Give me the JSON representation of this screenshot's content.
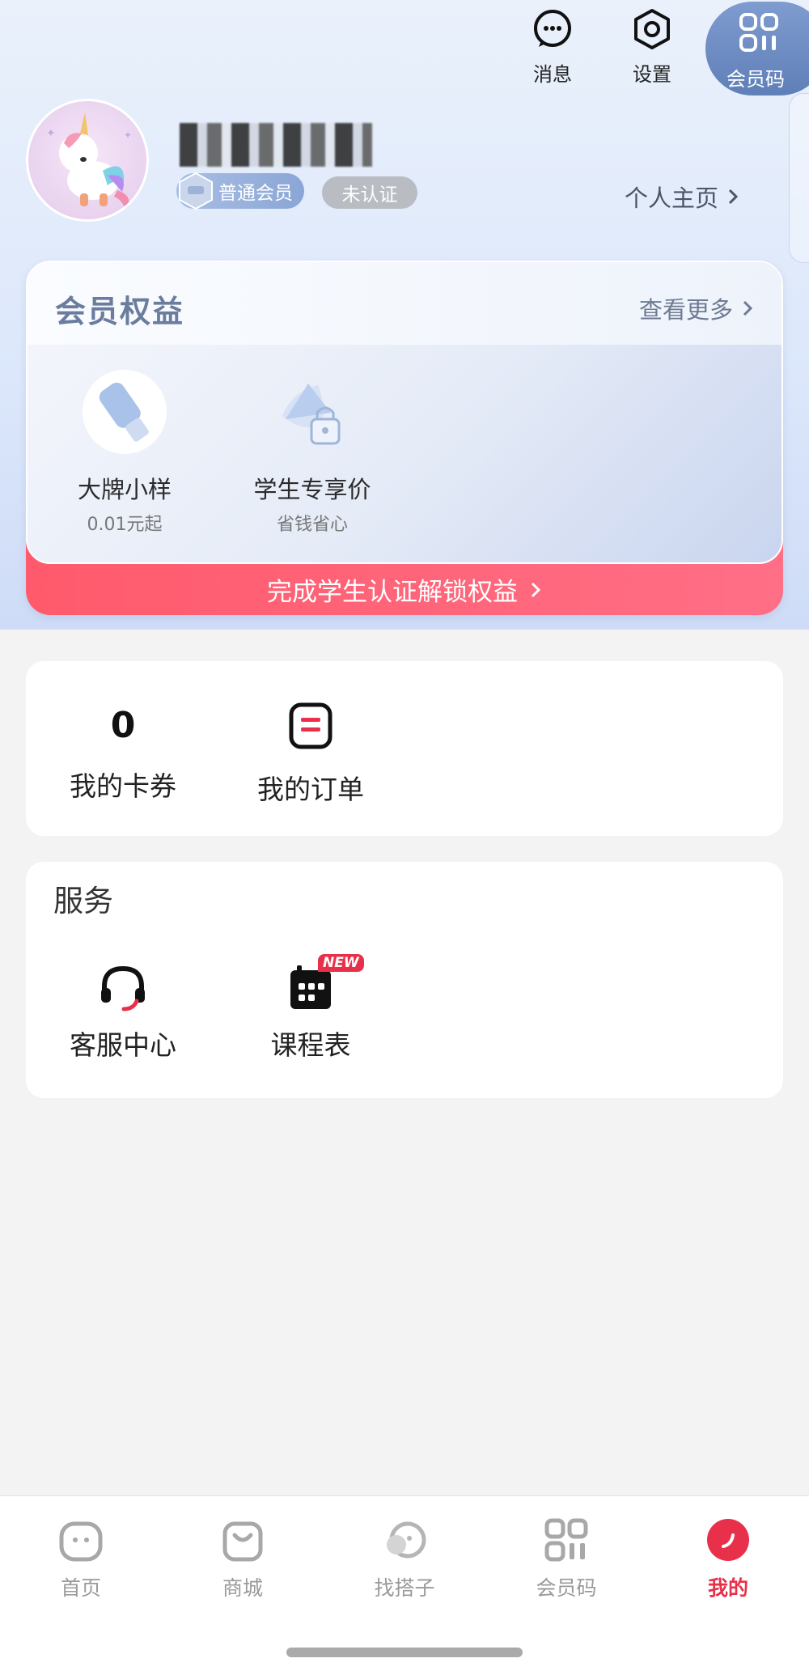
{
  "top_actions": {
    "messages_label": "消息",
    "settings_label": "设置",
    "member_code_label": "会员码"
  },
  "profile": {
    "member_badge": "普通会员",
    "verification_status": "未认证",
    "homepage_link": "个人主页"
  },
  "benefits": {
    "title": "会员权益",
    "more_label": "查看更多",
    "items": [
      {
        "title": "大牌小样",
        "subtitle": "0.01元起",
        "icon": "sample-bottle-icon"
      },
      {
        "title": "学生专享价",
        "subtitle": "省钱省心",
        "icon": "student-cap-lock-icon"
      }
    ],
    "cta": "完成学生认证解锁权益"
  },
  "quick": {
    "coupons_count": "0",
    "coupons_label": "我的卡券",
    "orders_label": "我的订单"
  },
  "services": {
    "title": "服务",
    "items": [
      {
        "label": "客服中心",
        "icon": "headset-icon"
      },
      {
        "label": "课程表",
        "icon": "calendar-icon",
        "badge": "NEW"
      }
    ]
  },
  "tabbar": {
    "items": [
      {
        "label": "首页",
        "icon": "home-icon",
        "active": false
      },
      {
        "label": "商城",
        "icon": "shopping-bag-icon",
        "active": false
      },
      {
        "label": "找搭子",
        "icon": "partner-icon",
        "active": false
      },
      {
        "label": "会员码",
        "icon": "member-code-icon",
        "active": false
      },
      {
        "label": "我的",
        "icon": "profile-icon",
        "active": true
      }
    ]
  },
  "colors": {
    "accent": "#e8304a",
    "hero_bg": "#dde8fb",
    "page_bg": "#f3f3f3"
  }
}
